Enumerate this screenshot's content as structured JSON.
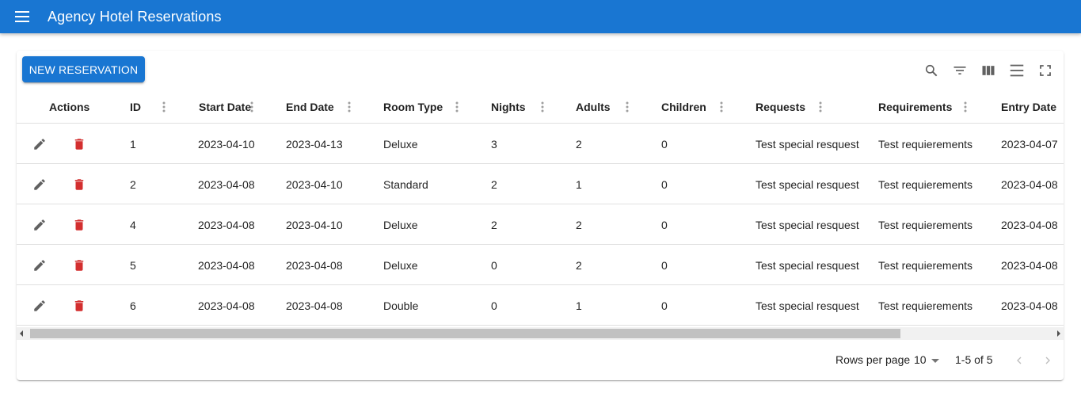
{
  "app": {
    "title": "Agency Hotel Reservations",
    "menu_icon": "menu-icon",
    "bar_color": "#1976d2"
  },
  "toolbar": {
    "new_label": "NEW RESERVATION",
    "icons": [
      "search-icon",
      "filter-icon",
      "columns-icon",
      "density-icon",
      "fullscreen-icon"
    ]
  },
  "columns": [
    "Actions",
    "ID",
    "Start Date",
    "End Date",
    "Room Type",
    "Nights",
    "Adults",
    "Children",
    "Requests",
    "Requirements",
    "Entry Date"
  ],
  "rows": [
    {
      "id": "1",
      "start": "2023-04-10",
      "end": "2023-04-13",
      "room": "Deluxe",
      "nights": "3",
      "adults": "2",
      "children": "0",
      "requests": "Test special resquest",
      "requirements": "Test requierements",
      "entry": "2023-04-07"
    },
    {
      "id": "2",
      "start": "2023-04-08",
      "end": "2023-04-10",
      "room": "Standard",
      "nights": "2",
      "adults": "1",
      "children": "0",
      "requests": "Test special resquest",
      "requirements": "Test requierements",
      "entry": "2023-04-08"
    },
    {
      "id": "4",
      "start": "2023-04-08",
      "end": "2023-04-10",
      "room": "Deluxe",
      "nights": "2",
      "adults": "2",
      "children": "0",
      "requests": "Test special resquest",
      "requirements": "Test requierements",
      "entry": "2023-04-08"
    },
    {
      "id": "5",
      "start": "2023-04-08",
      "end": "2023-04-08",
      "room": "Deluxe",
      "nights": "0",
      "adults": "2",
      "children": "0",
      "requests": "Test special resquest",
      "requirements": "Test requierements",
      "entry": "2023-04-08"
    },
    {
      "id": "6",
      "start": "2023-04-08",
      "end": "2023-04-08",
      "room": "Double",
      "nights": "0",
      "adults": "1",
      "children": "0",
      "requests": "Test special resquest",
      "requirements": "Test requierements",
      "entry": "2023-04-08"
    }
  ],
  "row_icons": {
    "edit": "edit-icon",
    "delete": "delete-icon",
    "delete_color": "#d32f2f"
  },
  "footer": {
    "rows_per_page_label": "Rows per page",
    "rows_per_page_value": "10",
    "range": "1-5 of 5"
  }
}
